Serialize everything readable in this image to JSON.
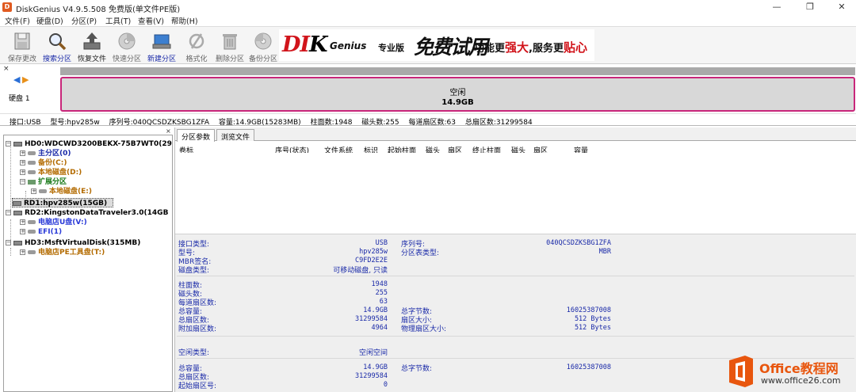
{
  "window": {
    "title": "DiskGenius V4.9.5.508 免费版(单文件PE版)",
    "app_icon_letter": "D",
    "controls": {
      "minimize": "—",
      "maximize": "❐",
      "close": "✕"
    }
  },
  "menu": [
    "文件(F)",
    "硬盘(D)",
    "分区(P)",
    "工具(T)",
    "查看(V)",
    "帮助(H)"
  ],
  "toolbar": [
    {
      "label": "保存更改",
      "icon": "save-icon",
      "state": "disabled"
    },
    {
      "label": "搜索分区",
      "icon": "search-icon",
      "state": "active"
    },
    {
      "label": "恢复文件",
      "icon": "recover-files-icon",
      "state": "normal"
    },
    {
      "label": "快速分区",
      "icon": "quick-partition-icon",
      "state": "disabled"
    },
    {
      "label": "新建分区",
      "icon": "new-partition-icon",
      "state": "active"
    },
    {
      "label": "格式化",
      "icon": "format-icon",
      "state": "disabled"
    },
    {
      "label": "删除分区",
      "icon": "delete-partition-icon",
      "state": "disabled"
    },
    {
      "label": "备份分区",
      "icon": "backup-partition-icon",
      "state": "disabled"
    }
  ],
  "banner": {
    "brand_left": "DI",
    "brand_k": "K",
    "brand_right": "Genius",
    "edition": "专业版",
    "trial": "免费试用",
    "slogan_a": "功能更",
    "slogan_b": "强大",
    "slogan_c": ",服务更",
    "slogan_d": "贴心"
  },
  "diskbar": {
    "close": "×",
    "nav_back": "◀",
    "nav_forward": "▶",
    "disk_label": "硬盘 1",
    "partition_name": "空闲",
    "partition_size": "14.9GB"
  },
  "infoline": {
    "interface": "接口:USB",
    "model": "型号:hpv285w",
    "serial": "序列号:040QCSDZKSBG1ZFA",
    "capacity": "容量:14.9GB(15283MB)",
    "cylinders": "柱面数:1948",
    "heads": "磁头数:255",
    "sectors_per_track": "每道扇区数:63",
    "total_sectors": "总扇区数:31299584"
  },
  "tree": {
    "close": "×",
    "nodes": [
      {
        "text": "HD0:WDCWD3200BEKX-75B7WT0(298GB)",
        "type": "disk",
        "level": 0,
        "expander": "−"
      },
      {
        "text": "主分区(0)",
        "type": "partition",
        "color": "blue",
        "level": 1,
        "expander": "+"
      },
      {
        "text": "备份(C:)",
        "type": "partition",
        "color": "orange",
        "level": 1,
        "expander": "+"
      },
      {
        "text": "本地磁盘(D:)",
        "type": "partition",
        "color": "orange",
        "level": 1,
        "expander": "+"
      },
      {
        "text": "扩展分区",
        "type": "extended",
        "color": "green",
        "level": 1,
        "expander": "−"
      },
      {
        "text": "本地磁盘(E:)",
        "type": "partition",
        "color": "orange",
        "level": 2,
        "expander": "+"
      },
      {
        "text": "RD1:hpv285w(15GB)",
        "type": "disk",
        "level": 0,
        "expander": "",
        "selected": true
      },
      {
        "text": "RD2:KingstonDataTraveler3.0(14GB",
        "type": "disk",
        "level": 0,
        "expander": "−"
      },
      {
        "text": "电脑店U盘(V:)",
        "type": "partition",
        "color": "blue2",
        "level": 1,
        "expander": "+"
      },
      {
        "text": "EFI(1)",
        "type": "partition",
        "color": "blue2",
        "level": 1,
        "expander": "+"
      },
      {
        "text": "HD3:MsftVirtualDisk(315MB)",
        "type": "disk",
        "level": 0,
        "expander": "−"
      },
      {
        "text": "电脑店PE工具盘(T:)",
        "type": "partition",
        "color": "orange",
        "level": 1,
        "expander": "+"
      }
    ]
  },
  "tabs": [
    "分区参数",
    "浏览文件"
  ],
  "columns": [
    "卷标",
    "序号(状态)",
    "文件系统",
    "标识",
    "起始柱面",
    "磁头",
    "扇区",
    "终止柱面",
    "磁头",
    "扇区",
    "容量"
  ],
  "details": {
    "disk": [
      {
        "label": "接口类型:",
        "value": "USB",
        "label2": "序列号:",
        "value2": "040QCSDZKSBG1ZFA"
      },
      {
        "label": "型号:",
        "value": "hpv285w",
        "label2": "分区表类型:",
        "value2": "MBR"
      },
      {
        "label": "MBR签名:",
        "value": "C9FD2E2E"
      },
      {
        "label": "磁盘类型:",
        "value": "可移动磁盘, 只读"
      }
    ],
    "geometry": [
      {
        "label": "柱面数:",
        "value": "1948"
      },
      {
        "label": "磁头数:",
        "value": "255"
      },
      {
        "label": "每道扇区数:",
        "value": "63"
      },
      {
        "label": "总容量:",
        "value": "14.9GB",
        "label2": "总字节数:",
        "value2": "16025387008"
      },
      {
        "label": "总扇区数:",
        "value": "31299584",
        "label2": "扇区大小:",
        "value2": "512 Bytes"
      },
      {
        "label": "附加扇区数:",
        "value": "4964",
        "label2": "物理扇区大小:",
        "value2": "512 Bytes"
      }
    ],
    "free_type_label": "空闲类型:",
    "free_type_value": "空闲空间",
    "free": [
      {
        "label": "总容量:",
        "value": "14.9GB",
        "label2": "总字节数:",
        "value2": "16025387008"
      },
      {
        "label": "总扇区数:",
        "value": "31299584"
      },
      {
        "label": "起始扇区号:",
        "value": "0"
      }
    ]
  },
  "watermark": {
    "brand": "Office教程网",
    "url": "www.office26.com"
  }
}
